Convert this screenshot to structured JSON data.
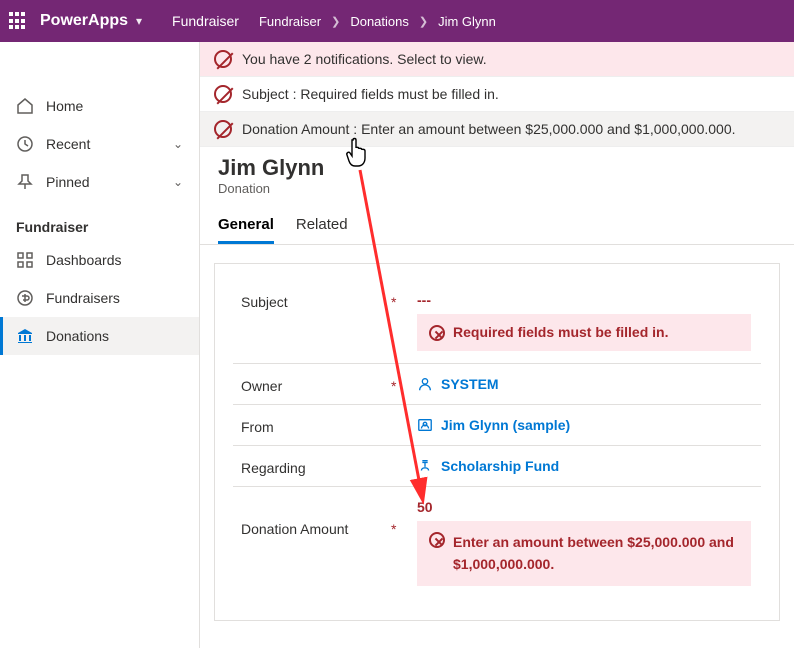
{
  "topbar": {
    "app_name": "PowerApps",
    "area": "Fundraiser",
    "breadcrumb": [
      "Fundraiser",
      "Donations",
      "Jim Glynn"
    ]
  },
  "nav": {
    "home": "Home",
    "recent": "Recent",
    "pinned": "Pinned",
    "section": "Fundraiser",
    "dashboards": "Dashboards",
    "fundraisers": "Fundraisers",
    "donations": "Donations"
  },
  "notifications": {
    "summary": "You have 2 notifications. Select to view.",
    "n1": "Subject : Required fields must be filled in.",
    "n2": "Donation Amount : Enter an amount between $25,000.000 and $1,000,000.000."
  },
  "record": {
    "title": "Jim Glynn",
    "type": "Donation"
  },
  "tabs": {
    "general": "General",
    "related": "Related"
  },
  "form": {
    "subject": {
      "label": "Subject",
      "value": "---",
      "error": "Required fields must be filled in."
    },
    "owner": {
      "label": "Owner",
      "value": "SYSTEM"
    },
    "from": {
      "label": "From",
      "value": "Jim Glynn (sample)"
    },
    "regarding": {
      "label": "Regarding",
      "value": "Scholarship Fund"
    },
    "amount": {
      "label": "Donation Amount",
      "value": "50",
      "error": "Enter an amount between $25,000.000 and $1,000,000.000."
    }
  }
}
